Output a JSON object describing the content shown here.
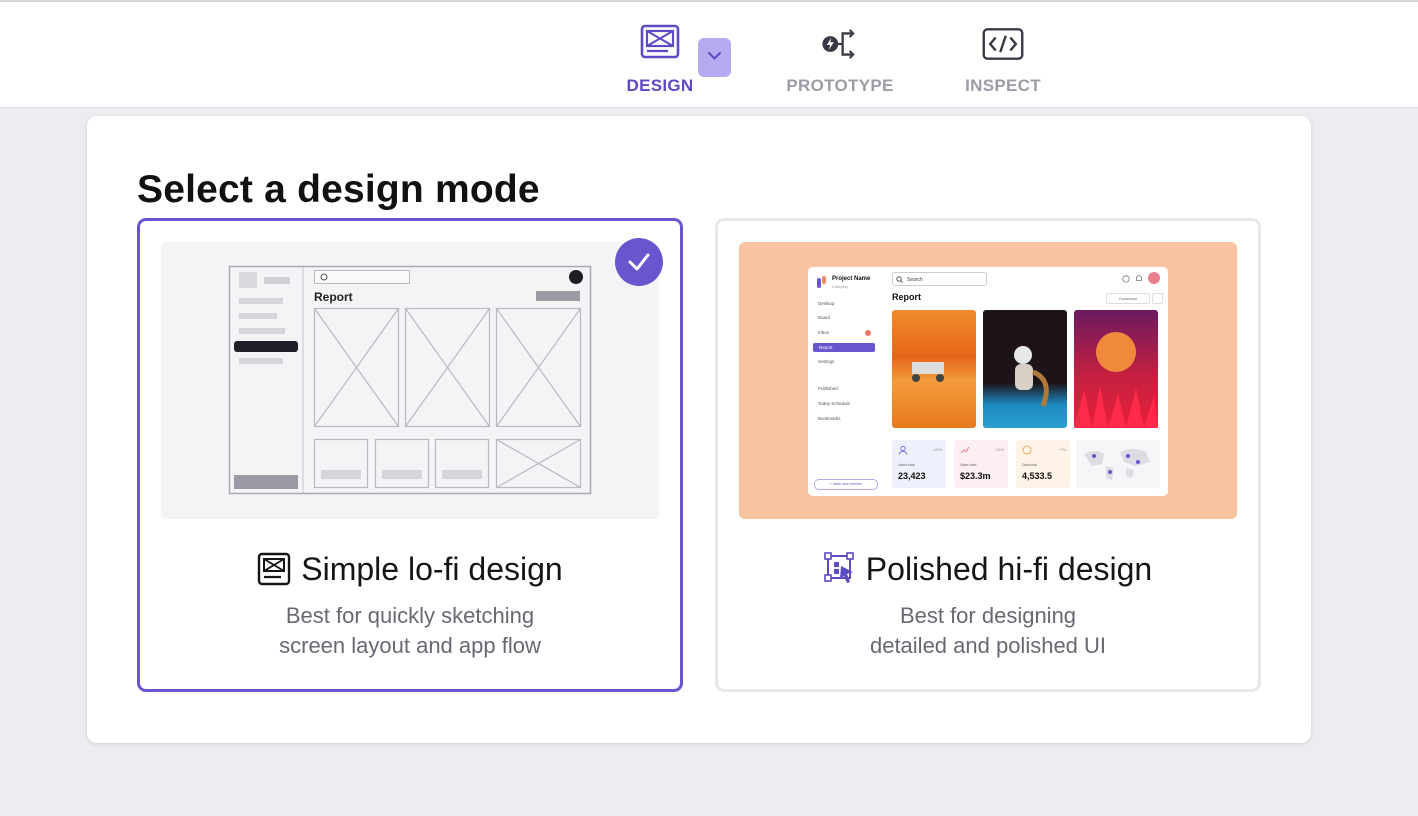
{
  "toolbar": {
    "tabs": [
      {
        "label": "DESIGN",
        "icon": "design-mode-icon",
        "active": true
      },
      {
        "label": "PROTOTYPE",
        "icon": "prototype-flow-icon",
        "active": false
      },
      {
        "label": "INSPECT",
        "icon": "code-brackets-icon",
        "active": false
      }
    ],
    "dropdown_icon": "chevron-down-icon"
  },
  "main": {
    "heading": "Select a design mode",
    "options": [
      {
        "title": "Simple lo-fi design",
        "description_line1": "Best for quickly sketching",
        "description_line2": "screen layout and app flow",
        "icon": "lofi-wireframe-icon",
        "selected": true,
        "preview": {
          "report_label": "Report"
        }
      },
      {
        "title": "Polished hi-fi design",
        "description_line1": "Best for designing",
        "description_line2": "detailed and polished UI",
        "icon": "hifi-design-icon",
        "selected": false,
        "preview": {
          "project_name": "Project Name",
          "category": "Category",
          "search": "Search",
          "report_label": "Report",
          "download": "Download",
          "nav": [
            "Desktop",
            "Board",
            "Inbox",
            "Report",
            "Settings",
            "Published",
            "Today Schedule",
            "Bookmarks"
          ],
          "invite": "+ Invite new member",
          "stats": [
            {
              "label": "Users total",
              "value": "23,423",
              "change": "+21%"
            },
            {
              "label": "Sales total",
              "value": "$23.3m",
              "change": "+21%"
            },
            {
              "label": "Data total",
              "value": "4,533.5",
              "change": "+7%"
            }
          ]
        }
      }
    ]
  },
  "colors": {
    "accent": "#6a55cf",
    "accent_light": "#b6aaf0",
    "hifi_bg": "#f8c3a1"
  }
}
